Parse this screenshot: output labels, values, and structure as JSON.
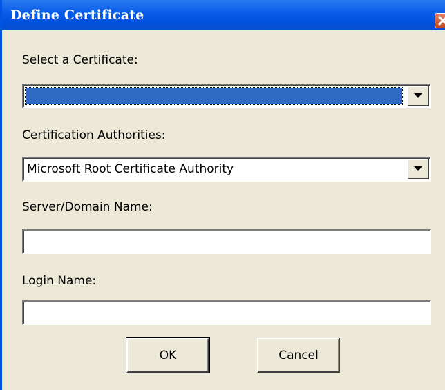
{
  "window": {
    "title": "Define Certificate",
    "title_bar_color": "#0054e3",
    "close_icon": "close-x-icon"
  },
  "form": {
    "certificate": {
      "label": "Select a Certificate:",
      "value": "",
      "selected_highlight_color": "#316ac5"
    },
    "authorities": {
      "label": "Certification Authorities:",
      "value": "Microsoft Root Certificate Authority"
    },
    "server": {
      "label": "Server/Domain Name:",
      "value": ""
    },
    "login": {
      "label": "Login Name:",
      "value": ""
    }
  },
  "buttons": {
    "ok_label": "OK",
    "cancel_label": "Cancel"
  }
}
